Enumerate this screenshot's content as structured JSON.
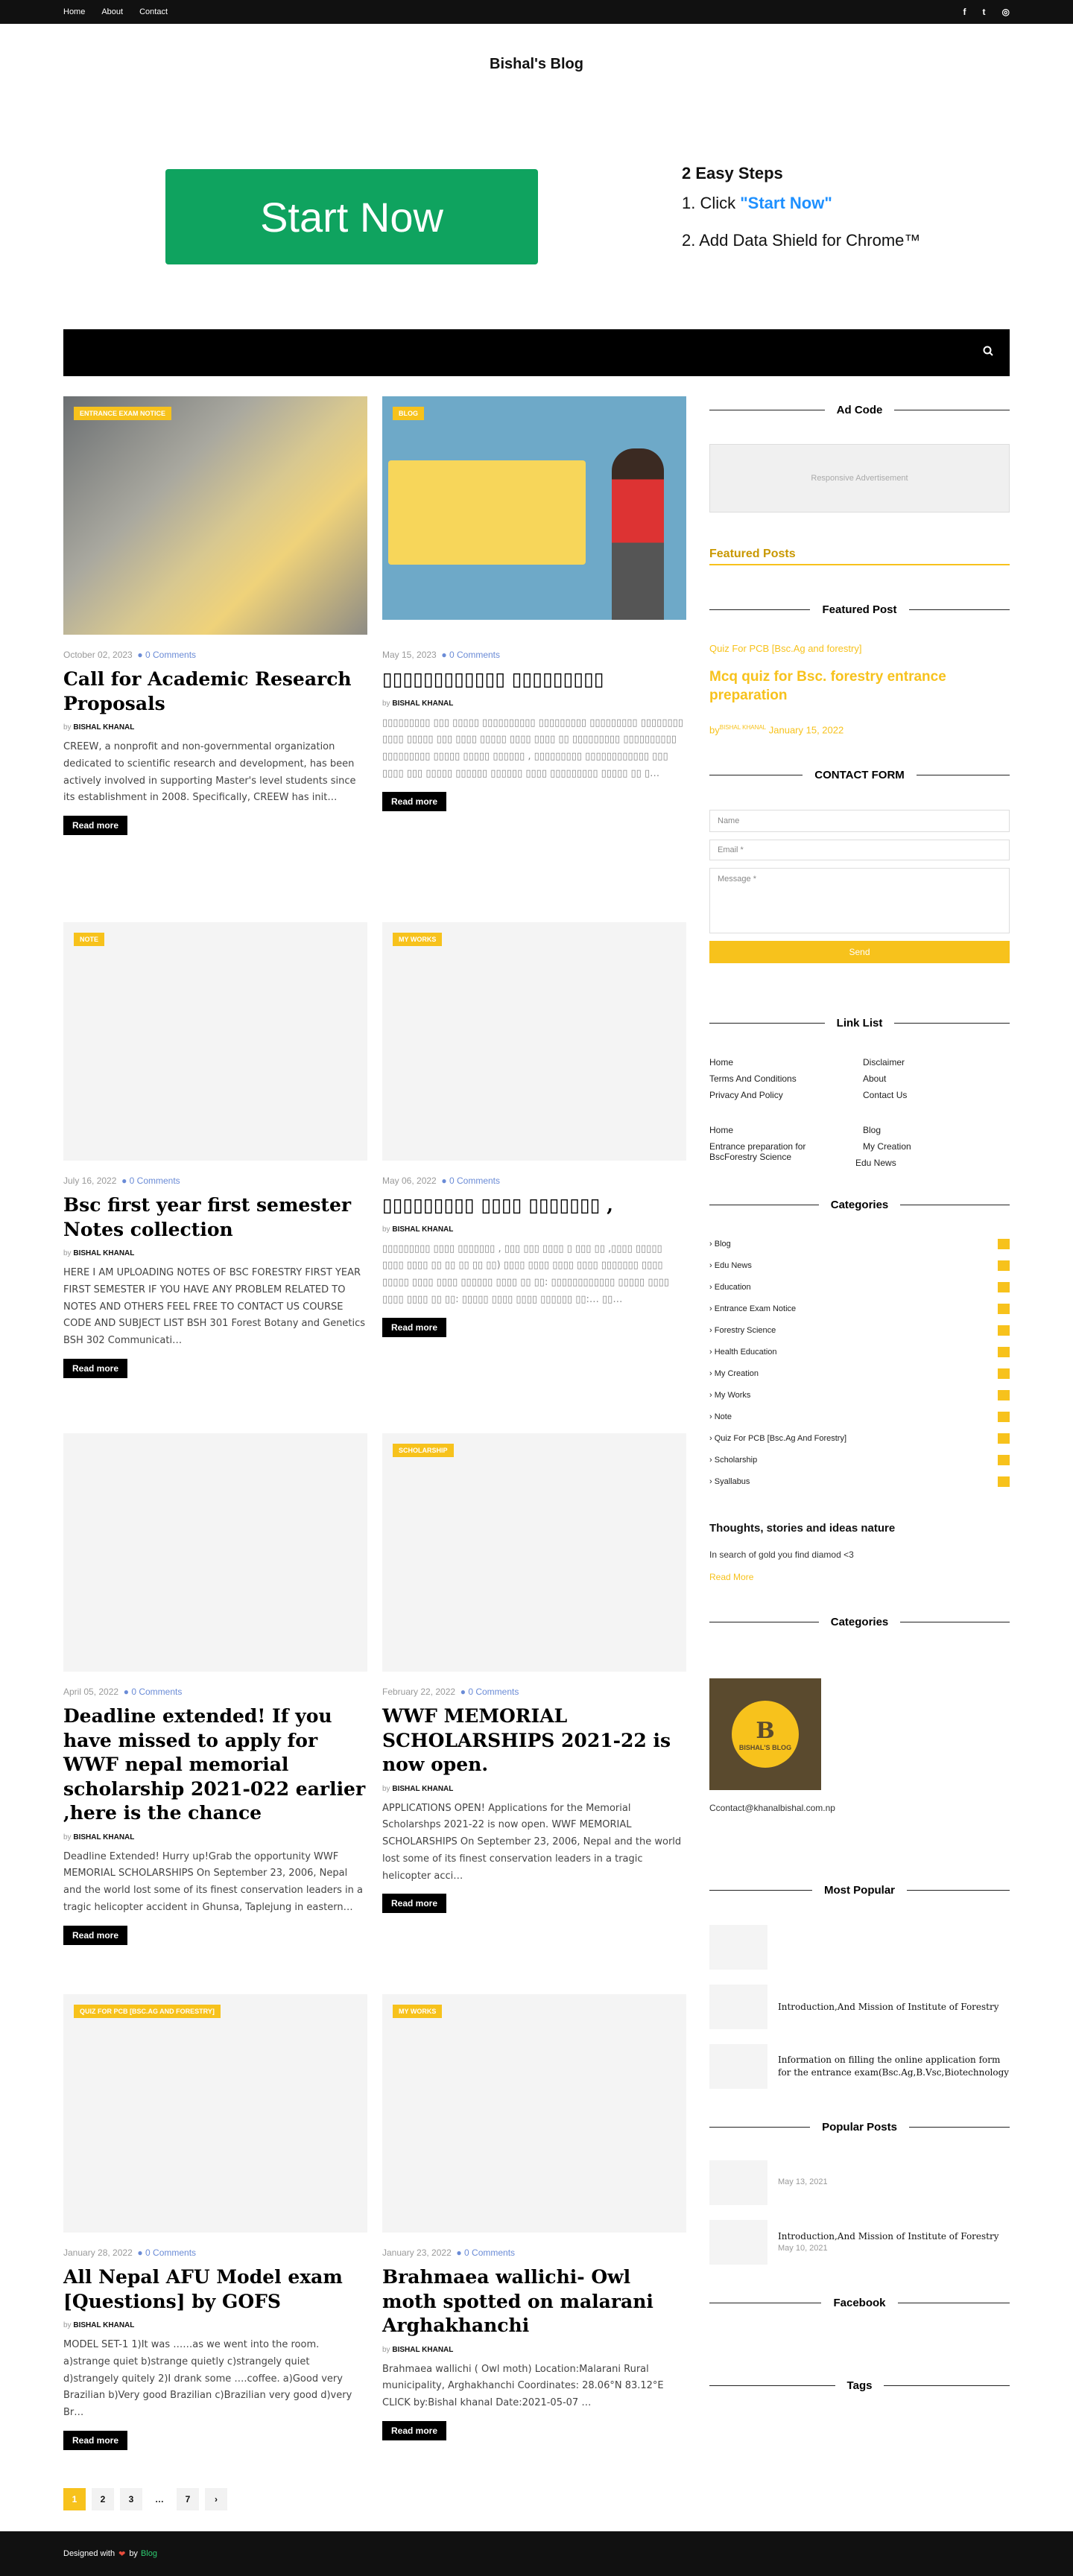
{
  "topnav": [
    "Home",
    "About",
    "Contact"
  ],
  "social": [
    "f",
    "t",
    "ig"
  ],
  "brand": "Bishal's Blog",
  "ad_banner": {
    "button": "Start Now",
    "heading": "2 Easy Steps",
    "step1_prefix": "1. Click ",
    "step1_link": "\"Start Now\"",
    "step2": "2. Add Data Shield for Chrome™"
  },
  "posts": [
    {
      "badge": "Entrance Exam Notice",
      "date": "October 02, 2023",
      "comments": "0 Comments",
      "title": "Call for Academic Research Proposals",
      "by": "by",
      "author": "BISHAL KHANAL",
      "excerpt": "CREEW, a nonprofit and non-governmental organization dedicated to scientific research and development, has been actively involved in supporting Master's level students since its establishment in 2008. Specifically, CREEW has init…",
      "read": "Read more"
    },
    {
      "badge": "Blog",
      "date": "May 15, 2023",
      "comments": "0 Comments",
      "title": "▯▯▯▯▯▯▯▯▯▯▯▯ ▯▯▯▯▯▯▯▯▯",
      "by": "by",
      "author": "BISHAL KHANAL",
      "excerpt": "▯▯▯▯▯▯▯▯▯ ▯▯▯ ▯▯▯▯▯ ▯▯▯▯▯▯▯▯▯▯ ▯▯▯▯▯▯▯▯▯ ▯▯▯▯▯▯▯▯▯ ▯▯▯▯▯▯▯▯ ▯▯▯▯ ▯▯▯▯▯ ▯▯▯ ▯▯▯▯ ▯▯▯▯▯ ▯▯▯▯ ▯▯▯▯ ▯▯ ▯▯▯▯▯▯▯▯▯ ▯▯▯▯▯▯▯▯▯▯ ▯▯▯▯▯▯▯▯▯ ▯▯▯▯▯ ▯▯▯▯▯ ▯▯▯▯▯▯ , ▯▯▯▯▯▯▯▯▯ ▯▯▯▯▯▯▯▯▯▯▯▯ ▯▯▯ ▯▯▯▯ ▯▯▯ ▯▯▯▯▯ ▯▯▯▯▯▯ ▯▯▯▯▯▯ ▯▯▯▯ ▯▯▯▯▯▯▯▯▯ ▯▯▯▯▯ ▯▯ ▯…",
      "read": "Read more"
    },
    {
      "badge": "Note",
      "date": "July 16, 2022",
      "comments": "0 Comments",
      "title": "Bsc first year first semester Notes collection",
      "by": "by",
      "author": "BISHAL KHANAL",
      "excerpt": "HERE I AM UPLOADING NOTES OF BSC FORESTRY FIRST YEAR FIRST SEMESTER IF YOU HAVE ANY PROBLEM RELATED TO NOTES AND OTHERS FEEL FREE TO CONTACT US COURSE CODE AND SUBJECT LIST BSH 301 Forest Botany and Genetics   BSH 302 Communicati…",
      "read": "Read more"
    },
    {
      "badge": "My Works",
      "date": "May 06, 2022",
      "comments": "0 Comments",
      "title": "▯▯▯▯▯▯▯▯▯ ▯▯▯▯ ▯▯▯▯▯▯▯ ,",
      "by": "by",
      "author": "BISHAL KHANAL",
      "excerpt": "▯▯▯▯▯▯▯▯▯ ▯▯▯▯ ▯▯▯▯▯▯▯ , ▯▯▯ ▯▯▯ ▯▯▯▯ ▯ ▯▯▯ ▯▯ ,▯▯▯▯ ▯▯▯▯▯ ▯▯▯▯ ▯▯▯▯ ▯▯ ▯▯ ▯▯ ▯▯ ▯▯) ▯▯▯▯ ▯▯▯▯ ▯▯▯▯ ▯▯▯▯ ▯▯▯▯▯▯▯ ▯▯▯▯ ▯▯▯▯▯ ▯▯▯▯ ▯▯▯▯ ▯▯▯▯▯▯ ▯▯▯▯ ▯▯ ▯▯: ▯▯▯▯▯▯▯▯▯▯▯▯ ▯▯▯▯▯ ▯▯▯▯ ▯▯▯▯ ▯▯▯▯ ▯▯ ▯▯: ▯▯▯▯▯ ▯▯▯▯ ▯▯▯▯ ▯▯▯▯▯▯ ▯▯:… ▯▯…",
      "read": "Read more"
    },
    {
      "badge": "",
      "date": "April 05, 2022",
      "comments": "0 Comments",
      "title": "Deadline extended! If you have missed to apply for WWF nepal memorial scholarship 2021-022 earlier ,here is the chance",
      "by": "by",
      "author": "BISHAL KHANAL",
      "excerpt": "Deadline Extended! Hurry up!Grab the opportunity WWF MEMORIAL SCHOLARSHIPS On September 23, 2006, Nepal and the world lost some of its finest conservation leaders in a tragic helicopter accident in Ghunsa, Taplejung in eastern…",
      "read": "Read more"
    },
    {
      "badge": "Scholarship",
      "date": "February 22, 2022",
      "comments": "0 Comments",
      "title": "WWF MEMORIAL SCHOLARSHIPS 2021-22 is now open.",
      "by": "by",
      "author": "BISHAL KHANAL",
      "excerpt": "APPLICATIONS OPEN! Applications for the Memorial Scholarshps 2021-22 is now open.  WWF MEMORIAL SCHOLARSHIPS On September 23, 2006, Nepal and the world lost some of its finest conservation leaders in a tragic helicopter acci…",
      "read": "Read more"
    },
    {
      "badge": "Quiz For PCB [Bsc.Ag And Forestry]",
      "date": "January 28, 2022",
      "comments": "0 Comments",
      "title": "All Nepal AFU Model exam [Questions] by GOFS",
      "by": "by",
      "author": "BISHAL KHANAL",
      "excerpt": "MODEL SET-1 1)It was ……as we went into the room. a)strange quiet  b)strange quietly c)strangely quiet d)strangely quitely 2)I drank some ….coffee. a)Good very Brazilian  b)Very good Brazilian c)Brazilian very good d)very Br…",
      "read": "Read more"
    },
    {
      "badge": "My Works",
      "date": "January 23, 2022",
      "comments": "0 Comments",
      "title": "Brahmaea wallichi- Owl moth spotted on malarani Arghakhanchi",
      "by": "by",
      "author": "BISHAL KHANAL",
      "excerpt": "Brahmaea wallichi ( Owl moth) Location:Malarani Rural municipality, Arghakhanchi Coordinates: 28.06°N 83.12°E                      CLICK by:Bishal khanal Date:2021-05-07                          …",
      "read": "Read more"
    }
  ],
  "pagination": [
    "1",
    "2",
    "3",
    "…",
    "7",
    "›"
  ],
  "sidebar": {
    "ad_code_title": "Ad Code",
    "ad_placeholder": "Responsive Advertisement",
    "featured_posts": "Featured Posts",
    "featured_post_title": "Featured Post",
    "featured_category": "Quiz For PCB [Bsc.Ag and forestry]",
    "featured_headline": "Mcq quiz for Bsc. forestry entrance preparation",
    "featured_by": "by",
    "featured_author": "BISHAL KHANAL",
    "featured_date": "January 15, 2022",
    "contact_title": "CONTACT FORM",
    "contact_name": "Name",
    "contact_email": "Email *",
    "contact_message": "Message *",
    "contact_send": "Send",
    "link_list_title": "Link List",
    "links": [
      "Home",
      "Disclaimer",
      "Terms And Conditions",
      "About",
      "Privacy And Policy",
      "Contact Us",
      "Home",
      "Blog",
      "Entrance preparation for BscForestry Science",
      "My Creation",
      "Edu News"
    ],
    "categories_title": "Categories",
    "categories": [
      "Blog",
      "Edu News",
      "Education",
      "Entrance Exam Notice",
      "Forestry Science",
      "Health Education",
      "My Creation",
      "My Works",
      "Note",
      "Quiz For PCB [Bsc.Ag And Forestry]",
      "Scholarship",
      "Syallabus"
    ],
    "tsi_title": "Thoughts, stories and ideas nature",
    "tsi_text": "In search of gold you find diamod <3",
    "tsi_more": "Read More",
    "categories2_title": "Categories",
    "logo_name": "BISHAL'S BLOG",
    "logo_letter": "B",
    "email": "Ccontact@khanalbishal.com.np",
    "most_popular_title": "Most Popular",
    "most_popular": [
      "",
      "Introduction,And Mission of Institute of Forestry",
      "Information on filling the online application form for the entrance exam(Bsc.Ag,B.Vsc,Biotechnology"
    ],
    "popular_posts_title": "Popular Posts",
    "popular_posts": [
      {
        "title": "",
        "date": "May 13, 2021"
      },
      {
        "title": "Introduction,And Mission of Institute of Forestry",
        "date": "May 10, 2021"
      }
    ],
    "facebook_title": "Facebook",
    "tags_title": "Tags"
  },
  "footer": {
    "prefix": "Designed with",
    "by": "by",
    "site": "Blog"
  }
}
